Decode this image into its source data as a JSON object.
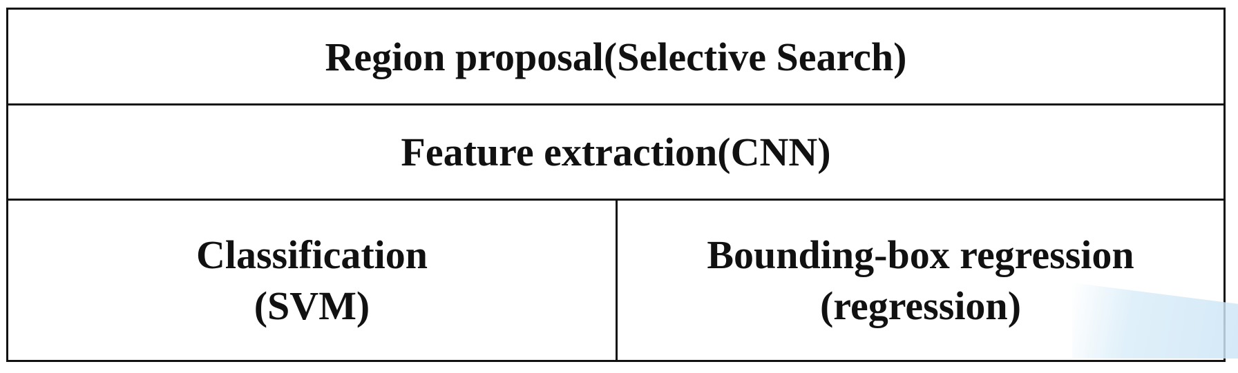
{
  "diagram": {
    "region_proposal": "Region proposal(Selective Search)",
    "feature_extraction": "Feature extraction(CNN)",
    "classification": {
      "line1": "Classification",
      "line2": "(SVM)"
    },
    "bbox_regression": {
      "line1": "Bounding-box regression",
      "line2": "(regression)"
    }
  }
}
